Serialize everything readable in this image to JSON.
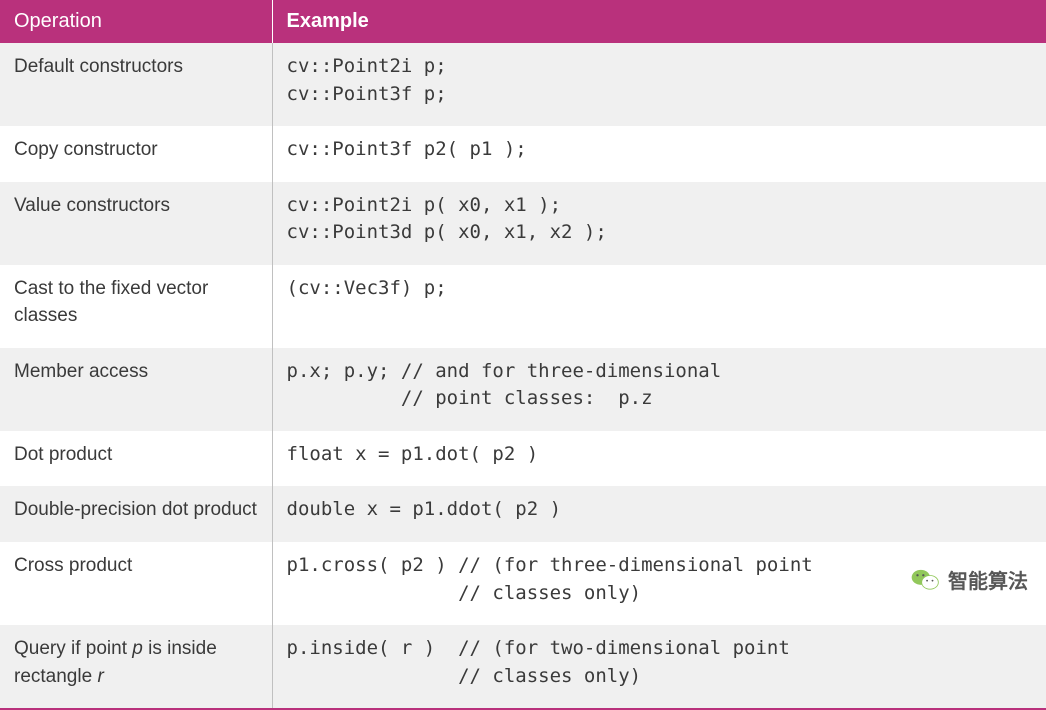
{
  "table": {
    "headers": {
      "operation": "Operation",
      "example": "Example"
    },
    "rows": [
      {
        "operation": "Default constructors",
        "example": "cv::Point2i p;\ncv::Point3f p;"
      },
      {
        "operation": "Copy constructor",
        "example": "cv::Point3f p2( p1 );"
      },
      {
        "operation": "Value constructors",
        "example": "cv::Point2i p( x0, x1 );\ncv::Point3d p( x0, x1, x2 );"
      },
      {
        "operation": "Cast to the fixed vector classes",
        "example": "(cv::Vec3f) p;"
      },
      {
        "operation": "Member access",
        "example": "p.x; p.y; // and for three-dimensional\n          // point classes:  p.z"
      },
      {
        "operation": "Dot product",
        "example": "float x = p1.dot( p2 )"
      },
      {
        "operation": "Double-precision dot product",
        "example": "double x = p1.ddot( p2 )"
      },
      {
        "operation": "Cross product",
        "example": "p1.cross( p2 ) // (for three-dimensional point\n               // classes only)"
      },
      {
        "operation_html": "Query if point <span class='em'>p</span> is inside rectangle <span class='em'>r</span>",
        "operation": "Query if point p is inside rectangle r",
        "example": "p.inside( r )  // (for two-dimensional point\n               // classes only)"
      }
    ]
  },
  "watermark": {
    "text": "智能算法"
  }
}
